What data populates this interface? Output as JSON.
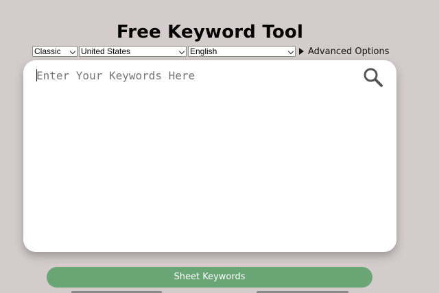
{
  "title": "Free Keyword Tool",
  "controls": {
    "mode": {
      "selected": "Classic"
    },
    "country": {
      "selected": "United States"
    },
    "language": {
      "selected": "English"
    },
    "advanced_label": "Advanced Options"
  },
  "search": {
    "placeholder": "Enter Your Keywords Here",
    "value": ""
  },
  "sheet_button_label": "Sheet Keywords",
  "colors": {
    "background": "#d3cbcc",
    "button_green": "#6aa576",
    "card": "#ffffff"
  },
  "icons": [
    "chevron-down-icon",
    "triangle-right-icon",
    "search-icon"
  ]
}
